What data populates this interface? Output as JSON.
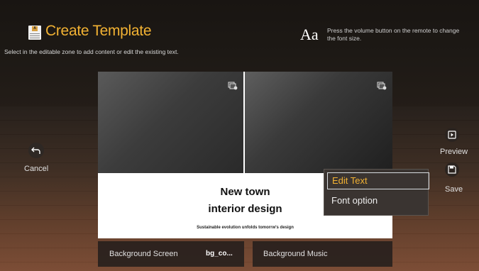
{
  "header": {
    "title": "Create Template",
    "subtitle": "Select in the editable zone to add content or edit the existing text.",
    "font_hint_glyph": "Aa",
    "font_hint": "Press the volume button on the remote to change the font size."
  },
  "side": {
    "cancel_label": "Cancel",
    "preview_label": "Preview",
    "save_label": "Save"
  },
  "template": {
    "heading_line1": "New town",
    "heading_line2": "interior design",
    "tagline": "Sustainable evolution unfolds tomorrw's design"
  },
  "context_menu": {
    "items": [
      "Edit Text",
      "Font option"
    ],
    "selected_index": 0
  },
  "bottom_bar": {
    "background_label": "Background Screen",
    "background_value": "bg_co...",
    "music_label": "Background Music"
  },
  "colors": {
    "accent": "#f2b233",
    "menu_bg": "#3a3431"
  },
  "icons": {
    "title": "template-icon",
    "cancel": "back-arrow-icon",
    "preview": "play-icon",
    "save": "save-icon",
    "image_change": "image-change-icon"
  }
}
